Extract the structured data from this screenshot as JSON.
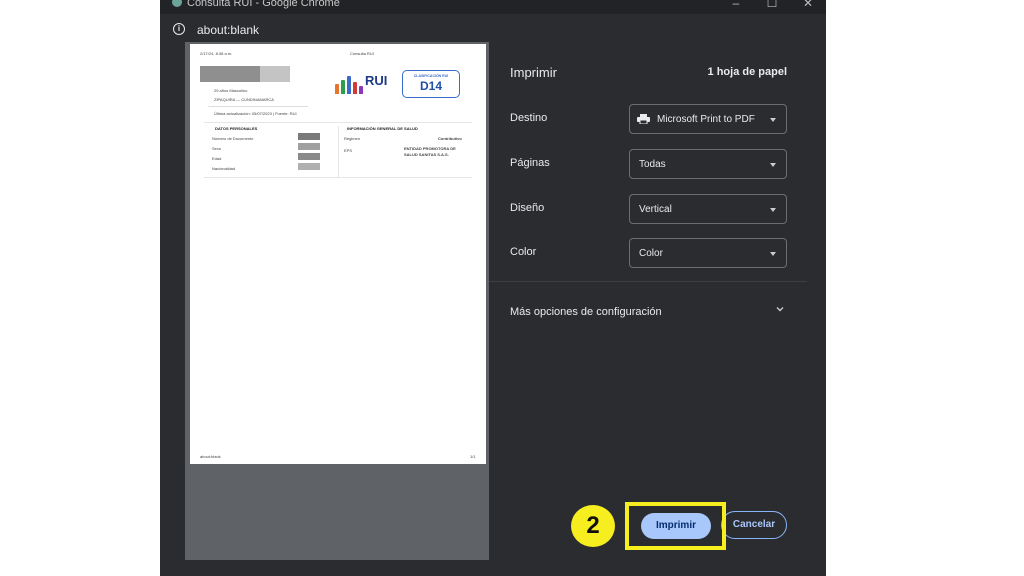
{
  "window": {
    "title": "Consulta RUI - Google Chrome",
    "url": "about:blank",
    "controls": {
      "minimize": "–",
      "maximize": "☐",
      "close": "✕"
    },
    "info_icon": "i"
  },
  "preview": {
    "header_left": "2/17/24, 8:38 a.m.",
    "header_right": "Consulta RUI",
    "person_line1": "29 años    Masculino",
    "person_line2": "ZIPAQUIRA — CUNDINAMARCA",
    "last_update": "Última actualización: 05/07/2023  |  Fuente: RUI",
    "logo_text": "RUI",
    "classification_label": "CLASIFICACIÓN RUI",
    "classification_code": "D14",
    "personal_title": "DATOS PERSONALES",
    "personal_fields": [
      "Número de Documento",
      "Sexo",
      "Edad",
      "Nacionalidad"
    ],
    "health_title": "INFORMACIÓN GENERAL DE SALUD",
    "health_regimen_label": "Régimen",
    "health_regimen_value": "Contributivo",
    "health_eps_label": "EPS",
    "health_eps_value_1": "ENTIDAD PROMOTORA DE",
    "health_eps_value_2": "SALUD SANITAS S.A.S.",
    "footer_left": "about:blank",
    "footer_right": "1/1"
  },
  "settings": {
    "title": "Imprimir",
    "sheets": "1 hoja de papel",
    "destination_label": "Destino",
    "destination_value": "Microsoft Print to PDF",
    "pages_label": "Páginas",
    "pages_value": "Todas",
    "layout_label": "Diseño",
    "layout_value": "Vertical",
    "color_label": "Color",
    "color_value": "Color",
    "more_options": "Más opciones de configuración",
    "print_button": "Imprimir",
    "cancel_button": "Cancelar"
  },
  "annotation": {
    "step_number": "2",
    "highlight_color": "#f7ee1f"
  },
  "icons": [
    "app-icon",
    "info-icon",
    "printer-icon",
    "chevron-down-icon",
    "rui-logo-icon"
  ]
}
